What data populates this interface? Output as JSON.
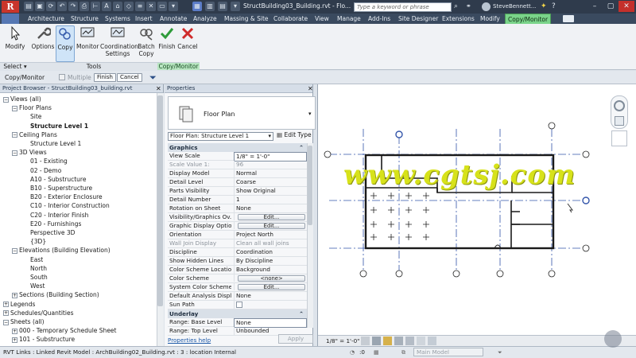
{
  "app": {
    "logo": "R",
    "title": "StructBuilding03_Building.rvt - Flo..."
  },
  "title_bar": {
    "search_placeholder": "Type a keyword or phrase",
    "user": "SteveBennett..."
  },
  "ribbon_tabs": [
    "Architecture",
    "Structure",
    "Systems",
    "Insert",
    "Annotate",
    "Analyze",
    "Massing & Site",
    "Collaborate",
    "View",
    "Manage",
    "Add-Ins",
    "Site Designer",
    "Extensions",
    "Modify",
    "Copy/Monitor"
  ],
  "ribbon": {
    "buttons": [
      {
        "label": "Modify",
        "icon": "cursor-icon"
      },
      {
        "label": "Options",
        "icon": "wrench-icon"
      },
      {
        "label": "Copy",
        "icon": "copy-icon"
      },
      {
        "label": "Monitor",
        "icon": "monitor-icon"
      },
      {
        "label": "Coordination Settings",
        "icon": "settings-icon"
      },
      {
        "label": "Batch Copy",
        "icon": "batch-copy-icon"
      },
      {
        "label": "Finish",
        "icon": "check-icon"
      },
      {
        "label": "Cancel",
        "icon": "x-icon"
      }
    ],
    "panels": {
      "select": "Select",
      "tools": "Tools",
      "copy_monitor": "Copy/Monitor"
    }
  },
  "options_bar": {
    "context": "Copy/Monitor",
    "multiple_label": "Multiple",
    "finish": "Finish",
    "cancel": "Cancel"
  },
  "project_browser": {
    "title": "Project Browser - StructBuilding03_building.rvt",
    "items": [
      {
        "label": "Views (all)",
        "level": 0,
        "toggle": "−"
      },
      {
        "label": "Floor Plans",
        "level": 1,
        "toggle": "−"
      },
      {
        "label": "Site",
        "level": 2
      },
      {
        "label": "Structure Level 1",
        "level": 2,
        "bold": true
      },
      {
        "label": "Ceiling Plans",
        "level": 1,
        "toggle": "−"
      },
      {
        "label": "Structure Level 1",
        "level": 2
      },
      {
        "label": "3D Views",
        "level": 1,
        "toggle": "−"
      },
      {
        "label": "01 - Existing",
        "level": 2
      },
      {
        "label": "02 - Demo",
        "level": 2
      },
      {
        "label": "A10 - Substructure",
        "level": 2
      },
      {
        "label": "B10 - Superstructure",
        "level": 2
      },
      {
        "label": "B20 - Exterior Enclosure",
        "level": 2
      },
      {
        "label": "C10 - Interior Construction",
        "level": 2
      },
      {
        "label": "C20 - Interior Finish",
        "level": 2
      },
      {
        "label": "E20 - Furnishings",
        "level": 2
      },
      {
        "label": "Perspective 3D",
        "level": 2
      },
      {
        "label": "{3D}",
        "level": 2
      },
      {
        "label": "Elevations (Building Elevation)",
        "level": 1,
        "toggle": "−"
      },
      {
        "label": "East",
        "level": 2
      },
      {
        "label": "North",
        "level": 2
      },
      {
        "label": "South",
        "level": 2
      },
      {
        "label": "West",
        "level": 2
      },
      {
        "label": "Sections (Building Section)",
        "level": 1,
        "toggle": "+"
      },
      {
        "label": "Legends",
        "level": 0,
        "toggle": "+"
      },
      {
        "label": "Schedules/Quantities",
        "level": 0,
        "toggle": "+"
      },
      {
        "label": "Sheets (all)",
        "level": 0,
        "toggle": "−"
      },
      {
        "label": "000 - Temporary Schedule Sheet",
        "level": 1,
        "toggle": "+"
      },
      {
        "label": "101 - Substructure",
        "level": 1,
        "toggle": "+"
      }
    ]
  },
  "properties": {
    "title": "Properties",
    "type_name": "Floor Plan",
    "type_selector": "Floor Plan: Structure Level 1",
    "edit_type": "Edit Type",
    "graphics_section": "Graphics",
    "rows": [
      {
        "k": "View Scale",
        "v": "1/8\" = 1'-0\""
      },
      {
        "k": "Scale Value    1:",
        "v": "96",
        "grey": true
      },
      {
        "k": "Display Model",
        "v": "Normal"
      },
      {
        "k": "Detail Level",
        "v": "Coarse"
      },
      {
        "k": "Parts Visibility",
        "v": "Show Original"
      },
      {
        "k": "Detail Number",
        "v": "1"
      },
      {
        "k": "Rotation on Sheet",
        "v": "None"
      },
      {
        "k": "Visibility/Graphics Ov...",
        "v": "Edit...",
        "btn": true
      },
      {
        "k": "Graphic Display Optio...",
        "v": "Edit...",
        "btn": true
      },
      {
        "k": "Orientation",
        "v": "Project North"
      },
      {
        "k": "Wall Join Display",
        "v": "Clean all wall joins",
        "grey": true
      },
      {
        "k": "Discipline",
        "v": "Coordination"
      },
      {
        "k": "Show Hidden Lines",
        "v": "By Discipline"
      },
      {
        "k": "Color Scheme Location",
        "v": "Background"
      },
      {
        "k": "Color Scheme",
        "v": "<none>",
        "btn": true
      },
      {
        "k": "System Color Schemes",
        "v": "Edit...",
        "btn": true
      },
      {
        "k": "Default Analysis Displ...",
        "v": "None"
      },
      {
        "k": "Sun Path",
        "v": "",
        "check": true
      }
    ],
    "underlay_section": "Underlay",
    "underlay_rows": [
      {
        "k": "Range: Base Level",
        "v": "None"
      },
      {
        "k": "Range: Top Level",
        "v": "Unbounded"
      }
    ],
    "help_link": "Properties help",
    "apply": "Apply"
  },
  "view_control_bar": {
    "scale": "1/8\" = 1'-0\""
  },
  "status_bar": {
    "message": "RVT Links : Linked Revit Model : ArchBuilding02_Building.rvt : 3 : location Internal",
    "selection_count": ":0",
    "model": "Main Model"
  },
  "watermark": "www.cgtsj.com",
  "colors": {
    "accent_tab": "#7ad48a",
    "title_bar": "#2f3b4c",
    "grid_line": "#3355aa"
  }
}
